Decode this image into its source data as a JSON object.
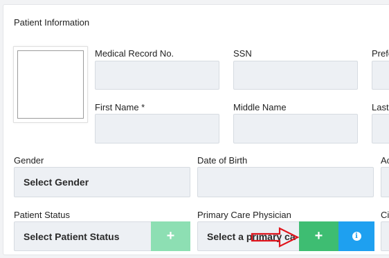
{
  "section": {
    "title": "Patient Information"
  },
  "fields": {
    "mrn": {
      "label": "Medical Record No.",
      "value": ""
    },
    "ssn": {
      "label": "SSN",
      "value": ""
    },
    "preferred": {
      "label": "Prefe"
    },
    "first_name": {
      "label": "First Name *",
      "value": ""
    },
    "middle_name": {
      "label": "Middle Name",
      "value": ""
    },
    "last_name": {
      "label": "Last"
    },
    "gender": {
      "label": "Gender",
      "selected": "Select Gender"
    },
    "dob": {
      "label": "Date of Birth",
      "value": ""
    },
    "address": {
      "label": "Ac"
    },
    "patient_status": {
      "label": "Patient Status",
      "selected": "Select Patient Status",
      "add_label": "+"
    },
    "pcp": {
      "label": "Primary Care Physician",
      "selected": "Select a primary ca",
      "add_label": "+",
      "info_label": "i"
    },
    "city": {
      "label": "Ci"
    }
  },
  "colors": {
    "add_disabled": "#8ddfb3",
    "add_active": "#3ebd72",
    "info": "#1ea0f0",
    "annotation_arrow": "#e0141c"
  },
  "icons": {
    "add": "plus-icon",
    "info": "info-icon",
    "annotation": "red-arrow-annotation"
  }
}
